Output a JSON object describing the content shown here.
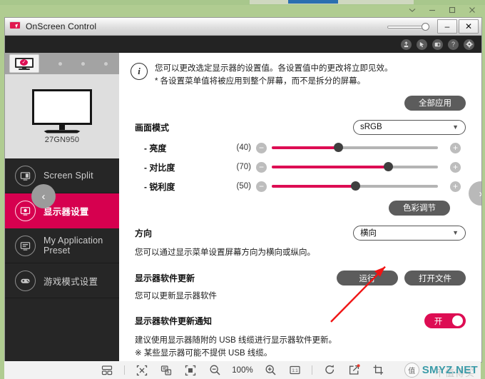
{
  "host_window": {
    "controls": [
      {
        "name": "chevron-down",
        "glyph": "⌄"
      },
      {
        "name": "minimize",
        "glyph": "–"
      },
      {
        "name": "maximize",
        "glyph": "□"
      },
      {
        "name": "close",
        "glyph": "✕"
      }
    ]
  },
  "app": {
    "title": "OnScreen Control",
    "icon": "monitor-cursor-icon",
    "titlebar_buttons": [
      {
        "name": "minimize-button",
        "label": "–"
      },
      {
        "name": "close-button",
        "label": "✕"
      }
    ],
    "toolbar_icons": [
      {
        "name": "screen-update-icon",
        "glyph": "↑"
      },
      {
        "name": "cursor-settings-icon",
        "glyph": "➤"
      },
      {
        "name": "screen-split-icon",
        "glyph": "◧"
      },
      {
        "name": "help-icon",
        "glyph": "?"
      },
      {
        "name": "settings-gear-icon",
        "glyph": "⚙"
      }
    ]
  },
  "sidebar": {
    "monitor_tab_badge": "✓",
    "monitor_dots": 3,
    "monitor_name": "27GN950",
    "collapse_glyph": "‹",
    "items": [
      {
        "label": "Screen Split",
        "icon": "screen-split-icon",
        "active": false
      },
      {
        "label": "显示器设置",
        "icon": "monitor-settings-icon",
        "active": true
      },
      {
        "label": "My Application Preset",
        "icon": "application-preset-icon",
        "active": false
      },
      {
        "label": "游戏模式设置",
        "icon": "gamepad-icon",
        "active": false
      }
    ]
  },
  "content": {
    "info_icon": "info-icon",
    "info_line1": "您可以更改选定显示器的设置值。各设置值中的更改将立即见效。",
    "info_line2": "* 各设置菜单值将被应用到整个屏幕，而不是拆分的屏幕。",
    "apply_all_label": "全部应用",
    "picture_mode_label": "画面模式",
    "picture_mode_value": "sRGB",
    "sliders": [
      {
        "label": "- 亮度",
        "value": "(40)",
        "percent": 40
      },
      {
        "label": "- 对比度",
        "value": "(70)",
        "percent": 70
      },
      {
        "label": "- 锐利度",
        "value": "(50)",
        "percent": 50
      }
    ],
    "color_adjust_label": "色彩调节",
    "orientation_label": "方向",
    "orientation_value": "横向",
    "orientation_desc": "您可以通过显示菜单设置屏幕方向为横向或纵向。",
    "fw_update_label": "显示器软件更新",
    "fw_update_desc": "您可以更新显示器软件",
    "run_label": "运行",
    "open_file_label": "打开文件",
    "fw_notify_label": "显示器软件更新通知",
    "fw_notify_toggle": "开",
    "fw_notify_line1": "建议使用显示器随附的 USB 线缆进行显示器软件更新。",
    "fw_notify_line2": "※ 某些显示器可能不提供 USB 线缆。",
    "next_glyph": "›"
  },
  "bottom_toolbar": {
    "zoom_level": "100%",
    "icons": [
      {
        "name": "layout-grid-icon",
        "glyph": "⬚"
      },
      {
        "name": "selection-tool-icon",
        "glyph": "✕"
      },
      {
        "name": "translate-icon",
        "glyph": "A"
      },
      {
        "name": "fit-screen-icon",
        "glyph": "□"
      },
      {
        "name": "zoom-out-icon",
        "glyph": "−"
      },
      {
        "name": "zoom-in-icon",
        "glyph": "+"
      },
      {
        "name": "actual-size-icon",
        "glyph": "1:1"
      },
      {
        "name": "rotate-icon",
        "glyph": "↻"
      },
      {
        "name": "edit-export-icon",
        "glyph": "↗"
      },
      {
        "name": "crop-icon",
        "glyph": "⬚"
      }
    ]
  },
  "watermark": {
    "mark_char": "值",
    "text": "SMYZ.NET",
    "faint_text": "不值得买"
  },
  "colors": {
    "accent_pink": "#dd0d53",
    "nav_active": "#d6004f",
    "sidebar_bg": "#262626",
    "toolbar_bg": "#232323",
    "button_gray": "#5c5c5c",
    "desktop_green": "#b0cc91"
  }
}
